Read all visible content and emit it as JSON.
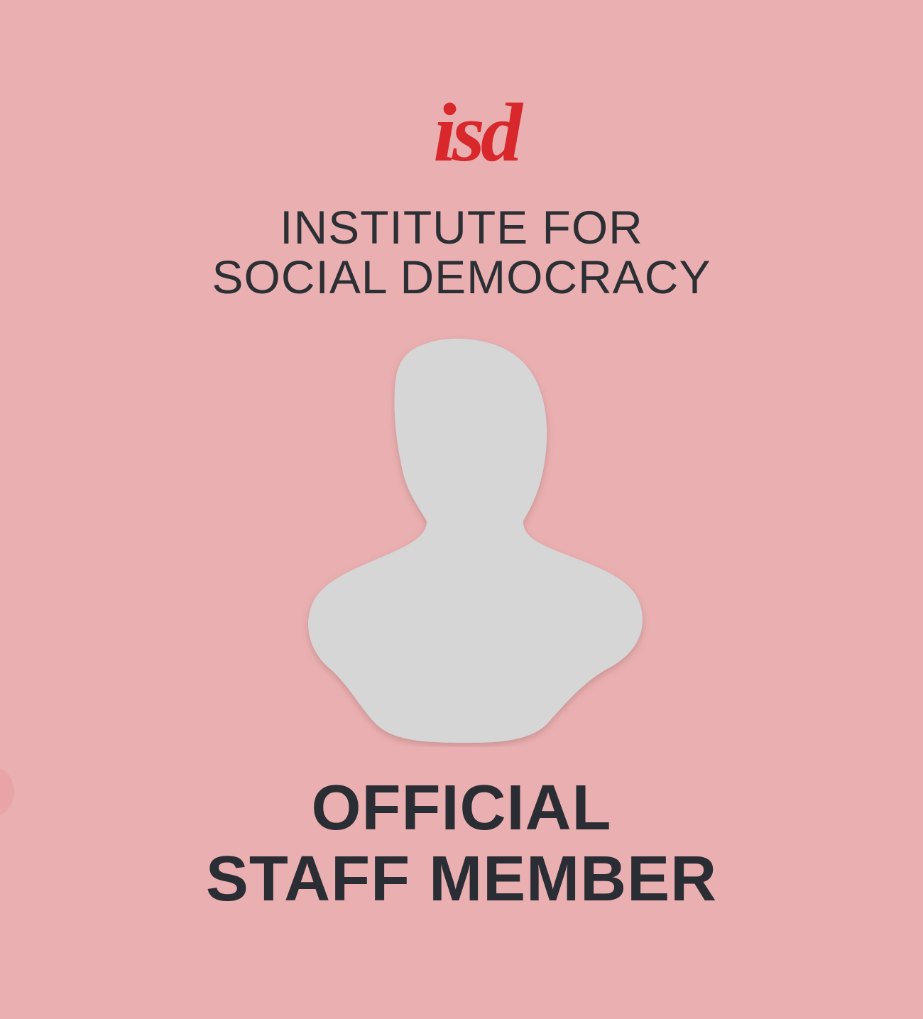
{
  "logo": {
    "text": "isd",
    "color": "#d8282c"
  },
  "organization": {
    "line1": "INSTITUTE FOR",
    "line2": "SOCIAL DEMOCRACY"
  },
  "photo_placeholder": {
    "icon": "person-silhouette-icon",
    "fill": "#d6d6d6"
  },
  "badge_title": {
    "line1": "OFFICIAL",
    "line2": "STAFF MEMBER"
  },
  "colors": {
    "background": "#eab0b1",
    "text": "#2c2f34",
    "accent": "#d8282c"
  }
}
